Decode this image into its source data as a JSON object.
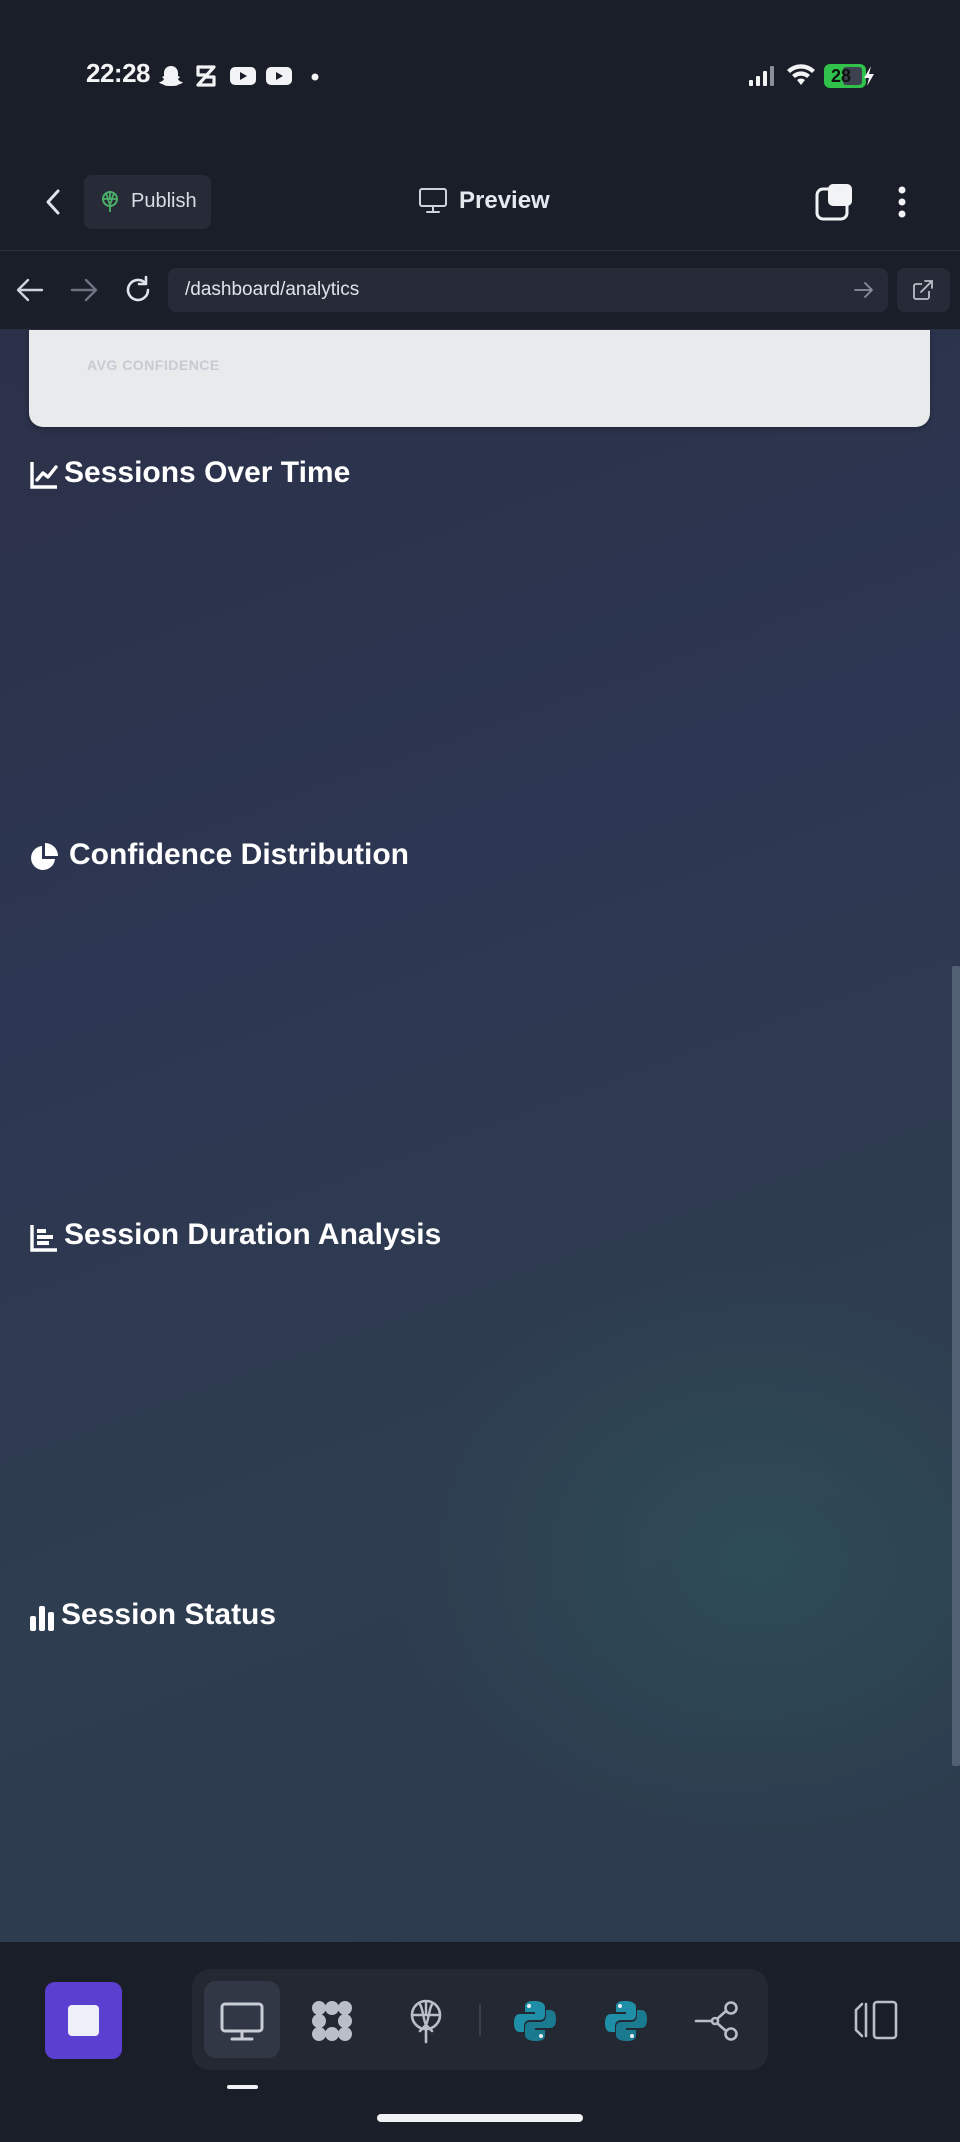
{
  "status_bar": {
    "time": "22:28",
    "battery": "28",
    "notification_icons": [
      "snapchat-icon",
      "zepto-icon",
      "youtube-icon",
      "youtube-icon",
      "dot-icon"
    ],
    "system_icons": [
      "signal-icon",
      "wifi-icon",
      "battery-icon",
      "charging-bolt-icon"
    ]
  },
  "header": {
    "publish_label": "Publish",
    "preview_label": "Preview"
  },
  "browser": {
    "url": "/dashboard/analytics"
  },
  "content": {
    "card_label": "AVG CONFIDENCE",
    "sections": [
      {
        "title": "Sessions Over Time",
        "icon": "line-chart-icon"
      },
      {
        "title": "Confidence Distribution",
        "icon": "pie-chart-icon"
      },
      {
        "title": "Session Duration Analysis",
        "icon": "horizontal-bar-chart-icon"
      },
      {
        "title": "Session Status",
        "icon": "bar-chart-icon"
      }
    ]
  },
  "dock": {
    "tools": [
      "desktop-icon",
      "grid-blob-icon",
      "deploy-icon",
      "python-icon",
      "python-icon",
      "share-nodes-icon"
    ],
    "active_tool": "desktop-icon"
  },
  "colors": {
    "accent": "#5b3fd1",
    "python_teal": "#1e8fa6",
    "publish_green": "#4caf6a",
    "battery_green": "#30c24b"
  }
}
